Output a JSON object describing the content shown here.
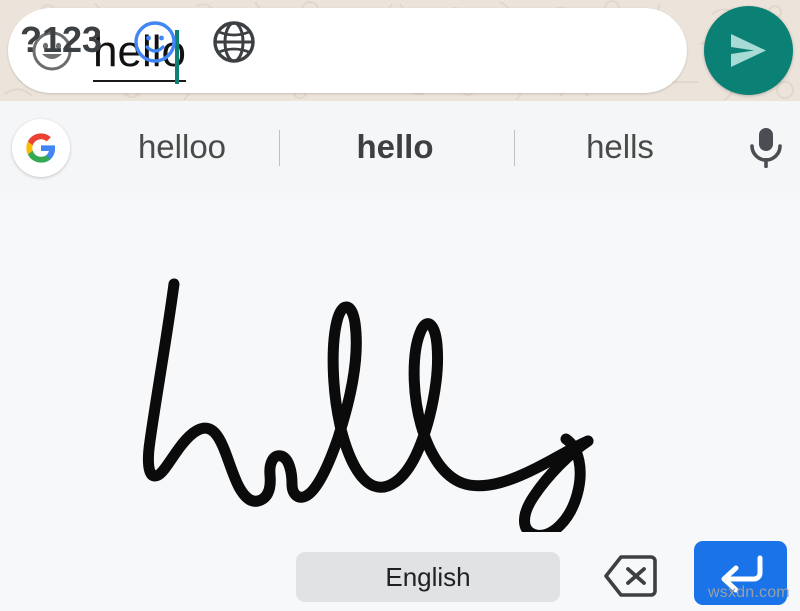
{
  "chat_input": {
    "emoji_icon": "smiley-face-icon",
    "composing_text": "hello",
    "send_icon": "send-arrow-icon",
    "accent_color": "#0A8174",
    "background_color": "#ECE3DA",
    "cursor_color": "#0E8074"
  },
  "suggestion_bar": {
    "logo_icon": "google-g-logo",
    "suggestions": [
      {
        "label": "helloo",
        "selected": false
      },
      {
        "label": "hello",
        "selected": true
      },
      {
        "label": "hells",
        "selected": false
      }
    ],
    "mic_icon": "microphone-icon",
    "background_color": "#F5F6F7"
  },
  "handwriting": {
    "canvas_label": "handwriting-input-canvas",
    "recognized_text": "hello",
    "ink_color": "#0B0B0B",
    "background_color": "#F7F8FA"
  },
  "keyboard_row": {
    "symbols_key": "?123",
    "emoji_key_icon": "smiley-face-icon",
    "globe_key_icon": "globe-icon",
    "space_key": "English",
    "backspace_icon": "backspace-icon",
    "enter_icon": "enter-return-icon",
    "enter_color": "#1A73E8",
    "emoji_key_color": "#4285F4"
  },
  "watermark": "wsxdn.com"
}
